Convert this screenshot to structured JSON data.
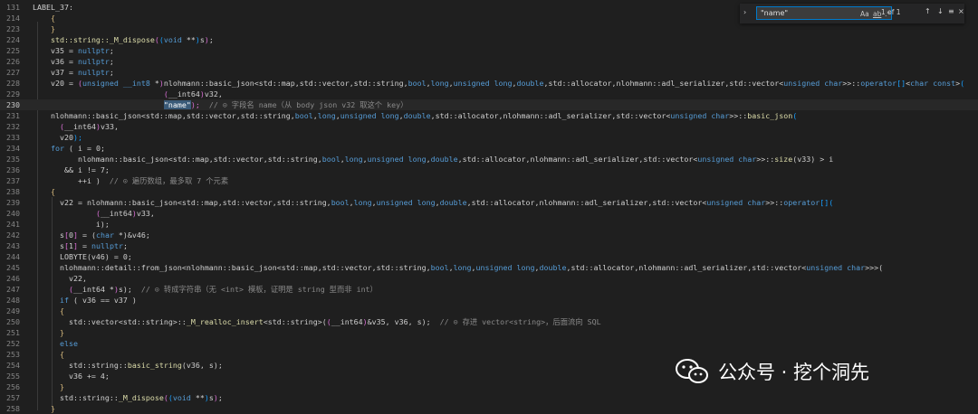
{
  "find": {
    "query": "\"name\"",
    "match_case": "Aa",
    "whole_word": "ab",
    "regex": ".*",
    "result": "1 of 1",
    "prev": "↑",
    "next": "↓",
    "selection": "≡",
    "close": "×",
    "toggle": "›"
  },
  "watermark": {
    "text": "公众号 · 挖个洞先"
  },
  "lines": [
    {
      "n": "131",
      "segs": [
        [
          "LABEL_37:",
          "t-var"
        ]
      ]
    },
    {
      "n": "214",
      "segs": [
        [
          "    {",
          "t-br"
        ]
      ]
    },
    {
      "n": "223",
      "segs": [
        [
          "    }",
          "t-br"
        ]
      ]
    },
    {
      "n": "224",
      "segs": [
        [
          "    ",
          "t-var"
        ],
        [
          "std::string::_M_dispose",
          "t-fn"
        ],
        [
          "(",
          "t-br2"
        ],
        [
          "(",
          "t-br3"
        ],
        [
          "void",
          "t-kw"
        ],
        [
          " **",
          "t-op"
        ],
        [
          ")",
          "t-br3"
        ],
        [
          "s",
          ""
        ],
        [
          ")",
          "t-br2"
        ],
        [
          ";",
          ""
        ]
      ]
    },
    {
      "n": "225",
      "segs": [
        [
          "    v35 = ",
          ""
        ],
        [
          "nullptr",
          "t-kw"
        ],
        [
          ";",
          ""
        ]
      ]
    },
    {
      "n": "226",
      "segs": [
        [
          "    v36 = ",
          ""
        ],
        [
          "nullptr",
          "t-kw"
        ],
        [
          ";",
          ""
        ]
      ]
    },
    {
      "n": "227",
      "segs": [
        [
          "    v37 = ",
          ""
        ],
        [
          "nullptr",
          "t-kw"
        ],
        [
          ";",
          ""
        ]
      ]
    },
    {
      "n": "228",
      "segs": [
        [
          "    v20 = ",
          ""
        ],
        [
          "(",
          "t-br2"
        ],
        [
          "unsigned __int8",
          "t-kw"
        ],
        [
          " *",
          "t-op"
        ],
        [
          ")",
          "t-br2"
        ],
        [
          "nlohmann::basic_json<std::map,std::vector,std::string,",
          ""
        ],
        [
          "bool",
          "t-kw"
        ],
        [
          ",",
          ""
        ],
        [
          "long",
          "t-kw"
        ],
        [
          ",",
          ""
        ],
        [
          "unsigned long",
          "t-kw"
        ],
        [
          ",",
          ""
        ],
        [
          "double",
          "t-kw"
        ],
        [
          ",std::allocator,nlohmann::adl_serializer,std::vector<",
          ""
        ],
        [
          "unsigned char",
          "t-kw"
        ],
        [
          ">>::",
          ""
        ],
        [
          "operator",
          "t-kw"
        ],
        [
          "[]",
          "t-br3"
        ],
        [
          "<",
          ""
        ],
        [
          "char const",
          "t-kw"
        ],
        [
          ">",
          "t-op"
        ],
        [
          "(",
          "t-br3"
        ]
      ]
    },
    {
      "n": "229",
      "segs": [
        [
          "                             ",
          "t-var"
        ],
        [
          "(",
          "t-br2"
        ],
        [
          "__int64",
          ""
        ],
        [
          ")",
          "t-br2"
        ],
        [
          "v32,",
          ""
        ]
      ]
    },
    {
      "n": "230",
      "segs": [
        [
          "                             ",
          ""
        ],
        [
          "\"name\"",
          "t-sel"
        ],
        [
          ");  ",
          "t-br2"
        ],
        [
          "// ⊙ 字段名 name（从 body json v32 取这个 key）",
          "t-cm"
        ]
      ],
      "current": true
    },
    {
      "n": "231",
      "segs": [
        [
          "    nlohmann::basic_json<std::map,std::vector,std::string,",
          ""
        ],
        [
          "bool",
          "t-kw"
        ],
        [
          ",",
          ""
        ],
        [
          "long",
          "t-kw"
        ],
        [
          ",",
          ""
        ],
        [
          "unsigned long",
          "t-kw"
        ],
        [
          ",",
          ""
        ],
        [
          "double",
          "t-kw"
        ],
        [
          ",std::allocator,nlohmann::adl_serializer,std::vector<",
          ""
        ],
        [
          "unsigned char",
          "t-kw"
        ],
        [
          ">>::",
          ""
        ],
        [
          "basic_json",
          "t-fn"
        ],
        [
          "(",
          "t-br3"
        ]
      ]
    },
    {
      "n": "232",
      "segs": [
        [
          "      ",
          ""
        ],
        [
          "(",
          "t-br2"
        ],
        [
          "__int64",
          ""
        ],
        [
          ")",
          "t-br2"
        ],
        [
          "v33,",
          ""
        ]
      ]
    },
    {
      "n": "233",
      "segs": [
        [
          "      v20",
          ""
        ],
        [
          ");",
          "t-br3"
        ]
      ]
    },
    {
      "n": "234",
      "segs": [
        [
          "    ",
          ""
        ],
        [
          "for",
          "t-kw"
        ],
        [
          " ( i = 0;",
          ""
        ]
      ]
    },
    {
      "n": "235",
      "segs": [
        [
          "          nlohmann::basic_json<std::map,std::vector,std::string,",
          ""
        ],
        [
          "bool",
          "t-kw"
        ],
        [
          ",",
          ""
        ],
        [
          "long",
          "t-kw"
        ],
        [
          ",",
          ""
        ],
        [
          "unsigned long",
          "t-kw"
        ],
        [
          ",",
          ""
        ],
        [
          "double",
          "t-kw"
        ],
        [
          ",std::allocator,nlohmann::adl_serializer,std::vector<",
          ""
        ],
        [
          "unsigned char",
          "t-kw"
        ],
        [
          ">>::",
          ""
        ],
        [
          "size",
          "t-fn"
        ],
        [
          "(v33) > i",
          ""
        ]
      ]
    },
    {
      "n": "236",
      "segs": [
        [
          "       && i != 7;",
          ""
        ]
      ]
    },
    {
      "n": "237",
      "segs": [
        [
          "          ++i )  ",
          ""
        ],
        [
          "// ⊙ 遍历数组，最多取 7 个元素",
          "t-cm"
        ]
      ]
    },
    {
      "n": "238",
      "segs": [
        [
          "    {",
          "t-br"
        ]
      ]
    },
    {
      "n": "239",
      "segs": [
        [
          "      v22 = nlohmann::basic_json<std::map,std::vector,std::string,",
          ""
        ],
        [
          "bool",
          "t-kw"
        ],
        [
          ",",
          ""
        ],
        [
          "long",
          "t-kw"
        ],
        [
          ",",
          ""
        ],
        [
          "unsigned long",
          "t-kw"
        ],
        [
          ",",
          ""
        ],
        [
          "double",
          "t-kw"
        ],
        [
          ",std::allocator,nlohmann::adl_serializer,std::vector<",
          ""
        ],
        [
          "unsigned char",
          "t-kw"
        ],
        [
          ">>::",
          ""
        ],
        [
          "operator",
          "t-kw"
        ],
        [
          "[](",
          "t-br3"
        ]
      ]
    },
    {
      "n": "240",
      "segs": [
        [
          "              ",
          ""
        ],
        [
          "(",
          "t-br2"
        ],
        [
          "__int64",
          ""
        ],
        [
          ")",
          "t-br2"
        ],
        [
          "v33,",
          ""
        ]
      ]
    },
    {
      "n": "241",
      "segs": [
        [
          "              i);",
          ""
        ]
      ]
    },
    {
      "n": "242",
      "segs": [
        [
          "      s",
          ""
        ],
        [
          "[",
          "t-br2"
        ],
        [
          "0",
          ""
        ],
        [
          "]",
          "t-br2"
        ],
        [
          " = (",
          ""
        ],
        [
          "char",
          "t-kw"
        ],
        [
          " *)&v46;",
          ""
        ]
      ]
    },
    {
      "n": "243",
      "segs": [
        [
          "      s",
          ""
        ],
        [
          "[",
          "t-br2"
        ],
        [
          "1",
          ""
        ],
        [
          "]",
          "t-br2"
        ],
        [
          " = ",
          ""
        ],
        [
          "nullptr",
          "t-kw"
        ],
        [
          ";",
          ""
        ]
      ]
    },
    {
      "n": "244",
      "segs": [
        [
          "      LOBYTE(v46) = 0;",
          ""
        ]
      ]
    },
    {
      "n": "245",
      "segs": [
        [
          "      nlohmann::detail::from_json<nlohmann::basic_json<std::map,std::vector,std::string,",
          ""
        ],
        [
          "bool",
          "t-kw"
        ],
        [
          ",",
          ""
        ],
        [
          "long",
          "t-kw"
        ],
        [
          ",",
          ""
        ],
        [
          "unsigned long",
          "t-kw"
        ],
        [
          ",",
          ""
        ],
        [
          "double",
          "t-kw"
        ],
        [
          ",std::allocator,nlohmann::adl_serializer,std::vector<",
          ""
        ],
        [
          "unsigned char",
          "t-kw"
        ],
        [
          ">>>(",
          "t-op"
        ]
      ]
    },
    {
      "n": "246",
      "segs": [
        [
          "        v22,",
          ""
        ]
      ]
    },
    {
      "n": "247",
      "segs": [
        [
          "        ",
          ""
        ],
        [
          "(",
          "t-br2"
        ],
        [
          "__int64",
          ""
        ],
        [
          " *",
          ""
        ],
        [
          ")",
          "t-br2"
        ],
        [
          "s);  ",
          ""
        ],
        [
          "// ⊙ 转成字符串（无 <int> 模板，证明是 string 型而非 int）",
          "t-cm"
        ]
      ]
    },
    {
      "n": "248",
      "segs": [
        [
          "      ",
          ""
        ],
        [
          "if",
          "t-kw"
        ],
        [
          " ( v36 == v37 )",
          ""
        ]
      ]
    },
    {
      "n": "249",
      "segs": [
        [
          "      {",
          "t-br"
        ]
      ]
    },
    {
      "n": "250",
      "segs": [
        [
          "        std::vector<std::string>::",
          ""
        ],
        [
          "_M_realloc_insert",
          "t-fn"
        ],
        [
          "<std::string>(",
          ""
        ],
        [
          "(",
          "t-br2"
        ],
        [
          "__int64",
          ""
        ],
        [
          ")",
          "t-br2"
        ],
        [
          "&v35, v36, s);  ",
          ""
        ],
        [
          "// ⊙ 存进 vector<string>，后面流向 SQL",
          "t-cm"
        ]
      ]
    },
    {
      "n": "251",
      "segs": [
        [
          "      }",
          "t-br"
        ]
      ]
    },
    {
      "n": "252",
      "segs": [
        [
          "      ",
          ""
        ],
        [
          "else",
          "t-kw"
        ]
      ]
    },
    {
      "n": "253",
      "segs": [
        [
          "      {",
          "t-br"
        ]
      ]
    },
    {
      "n": "254",
      "segs": [
        [
          "        std::string::",
          ""
        ],
        [
          "basic_string",
          "t-fn"
        ],
        [
          "(v36, s);",
          ""
        ]
      ]
    },
    {
      "n": "255",
      "segs": [
        [
          "        v36 += 4;",
          ""
        ]
      ]
    },
    {
      "n": "256",
      "segs": [
        [
          "      }",
          "t-br"
        ]
      ]
    },
    {
      "n": "257",
      "segs": [
        [
          "      std::string::",
          ""
        ],
        [
          "_M_dispose",
          "t-fn"
        ],
        [
          "(",
          "t-br2"
        ],
        [
          "(",
          "t-br3"
        ],
        [
          "void",
          "t-kw"
        ],
        [
          " **",
          "t-op"
        ],
        [
          ")",
          "t-br3"
        ],
        [
          "s",
          ""
        ],
        [
          ")",
          "t-br2"
        ],
        [
          ";",
          ""
        ]
      ]
    },
    {
      "n": "258",
      "segs": [
        [
          "    }",
          "t-br"
        ]
      ]
    }
  ]
}
